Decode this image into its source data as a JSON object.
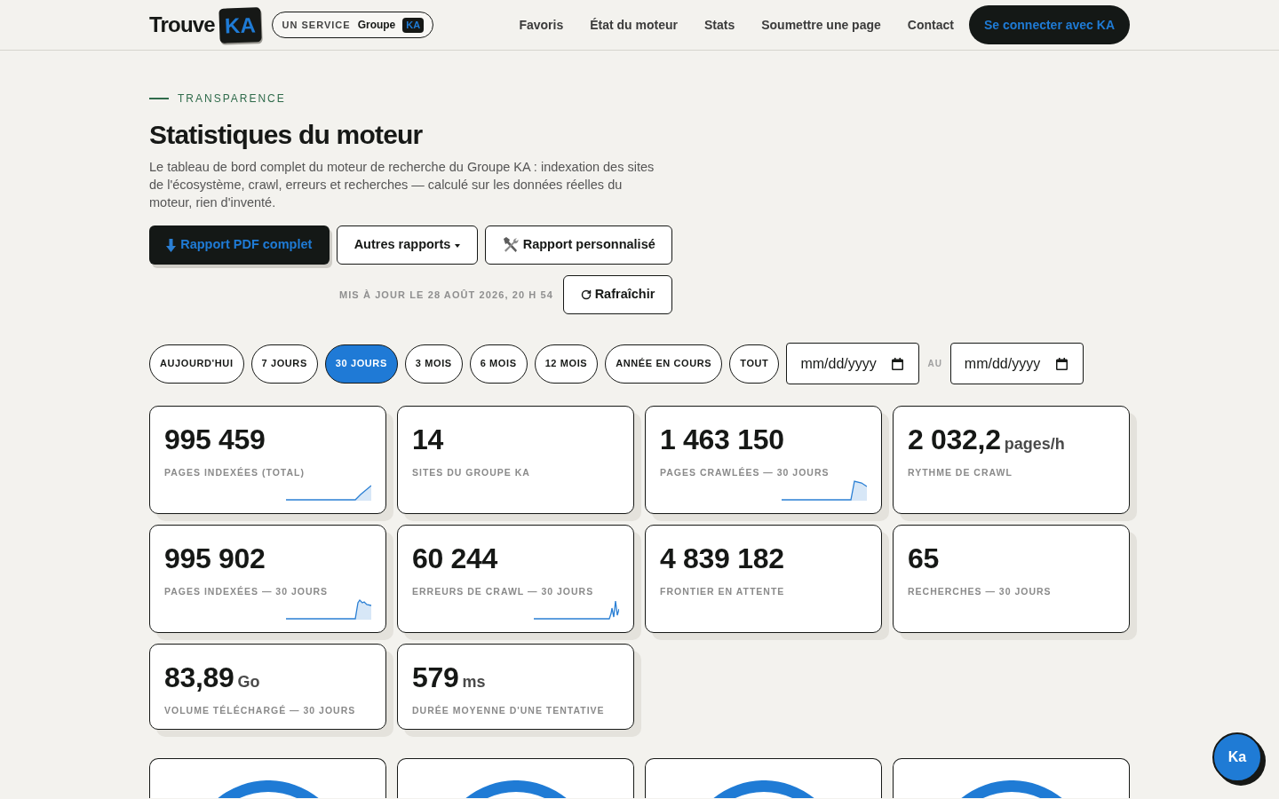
{
  "header": {
    "logo": {
      "word": "Trouve",
      "tile": "KA"
    },
    "service_badge": {
      "prefix": "UN SERVICE",
      "name": "Groupe",
      "tile": "KA"
    },
    "nav": [
      "Favoris",
      "État du moteur",
      "Stats",
      "Soumettre une page",
      "Contact"
    ],
    "login_button": "Se connecter avec KA"
  },
  "intro": {
    "eyebrow": "TRANSPARENCE",
    "title": "Statistiques du moteur",
    "description": "Le tableau de bord complet du moteur de recherche du Groupe KA : indexation des sites de l'écosystème, crawl, erreurs et recherches — calculé sur les données réelles du moteur, rien d'inventé.",
    "actions": [
      {
        "kind": "download",
        "label": "Rapport PDF complet"
      },
      {
        "kind": "dropdown",
        "label": "Autres rapports"
      },
      {
        "kind": "tools",
        "label": "Rapport personnalisé"
      }
    ],
    "updated": "MIS À JOUR LE 28 AOÛT 2026, 20 H 54",
    "refresh_button": "Rafraîchir"
  },
  "periods": [
    {
      "label": "AUJOURD'HUI",
      "selected": false
    },
    {
      "label": "7 JOURS",
      "selected": false
    },
    {
      "label": "30 JOURS",
      "selected": true
    },
    {
      "label": "3 MOIS",
      "selected": false
    },
    {
      "label": "6 MOIS",
      "selected": false
    },
    {
      "label": "12 MOIS",
      "selected": false
    },
    {
      "label": "ANNÉE EN COURS",
      "selected": false
    },
    {
      "label": "TOUT",
      "selected": false
    }
  ],
  "date_range": {
    "from": {
      "placeholder": "mm/dd/yyyy"
    },
    "separator": "AU",
    "to": {
      "placeholder": "mm/dd/yyyy"
    }
  },
  "metrics": [
    {
      "value": "995 459",
      "label": "PAGES INDEXÉES (TOTAL)",
      "sparkline": true
    },
    {
      "value": "14",
      "label": "SITES DU GROUPE KA",
      "sparkline": false
    },
    {
      "value": "1 463 150",
      "label": "PAGES CRAWLÉES — 30 JOURS",
      "sparkline": true
    },
    {
      "value": "2 032,2",
      "unit": "pages/h",
      "label": "RYTHME DE CRAWL",
      "sparkline": false
    },
    {
      "value": "995 902",
      "label": "PAGES INDEXÉES — 30 JOURS",
      "sparkline": true
    },
    {
      "value": "60 244",
      "label": "ERREURS DE CRAWL — 30 JOURS",
      "sparkline": true
    },
    {
      "value": "4 839 182",
      "label": "FRONTIER EN ATTENTE",
      "sparkline": false
    },
    {
      "value": "65",
      "label": "RECHERCHES — 30 JOURS",
      "sparkline": false
    },
    {
      "value": "83,89",
      "unit": "Go",
      "label": "VOLUME TÉLÉCHARGÉ — 30 JOURS",
      "sparkline": false
    },
    {
      "value": "579",
      "unit": "ms",
      "label": "DURÉE MOYENNE D'UNE TENTATIVE",
      "sparkline": false
    }
  ],
  "charts": [
    {
      "kind": "ring"
    },
    {
      "kind": "ring"
    },
    {
      "kind": "ring"
    },
    {
      "kind": "ring"
    }
  ],
  "chat_button": "Ka"
}
